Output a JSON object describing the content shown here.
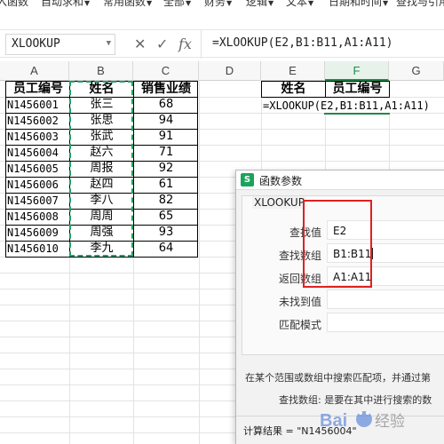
{
  "menu": {
    "items": [
      "入函数",
      "自动求和",
      "常用函数",
      "全部",
      "财务",
      "逻辑",
      "文本",
      "日期和时间",
      "查找与引用"
    ]
  },
  "formula_bar": {
    "name_box": "XLOOKUP",
    "cancel_icon": "✕",
    "confirm_icon": "✓",
    "fx_label": "fx",
    "formula": "=XLOOKUP(E2,B1:B11,A1:A11)"
  },
  "columns": [
    "A",
    "B",
    "C",
    "D",
    "E",
    "F",
    "G"
  ],
  "active_column": "F",
  "table": {
    "headers": [
      "员工编号",
      "姓名",
      "销售业绩"
    ],
    "rows": [
      [
        "N1456001",
        "张三",
        "68"
      ],
      [
        "N1456002",
        "张思",
        "94"
      ],
      [
        "N1456003",
        "张武",
        "91"
      ],
      [
        "N1456004",
        "赵六",
        "71"
      ],
      [
        "N1456005",
        "周报",
        "92"
      ],
      [
        "N1456006",
        "赵四",
        "61"
      ],
      [
        "N1456007",
        "李八",
        "82"
      ],
      [
        "N1456008",
        "周周",
        "65"
      ],
      [
        "N1456009",
        "周强",
        "93"
      ],
      [
        "N1456010",
        "李九",
        "64"
      ]
    ]
  },
  "lookup": {
    "headers": [
      "姓名",
      "员工编号"
    ],
    "formula_cell": "=XLOOKUP(E2,B1:B11,A1:A11)"
  },
  "dialog": {
    "title": "函数参数",
    "logo": "S",
    "function_name": "XLOOKUP",
    "args": [
      {
        "label": "查找值",
        "value": "E2"
      },
      {
        "label": "查找数组",
        "value": "B1:B11"
      },
      {
        "label": "返回数组",
        "value": "A1:A11"
      },
      {
        "label": "未找到值",
        "value": ""
      },
      {
        "label": "匹配模式",
        "value": ""
      }
    ],
    "description": "在某个范围或数组中搜索匹配项，并通过第",
    "arg_description": "查找数组:  是要在其中进行搜索的数",
    "result": "计算结果 = \"N1456004\""
  },
  "watermark": "Baidu 经验",
  "colors": {
    "accent_green": "#1e8a4c",
    "marquee_green": "#20a06a",
    "highlight_red": "#e02020"
  }
}
